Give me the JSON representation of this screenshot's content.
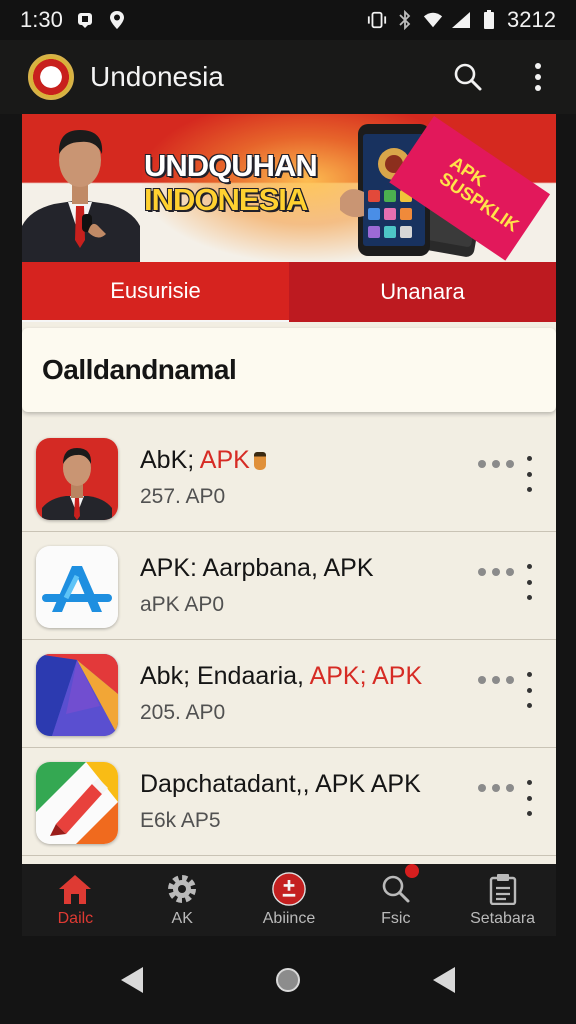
{
  "status_bar": {
    "time": "1:30",
    "right_text": "3212",
    "icons": [
      "notification-icon",
      "location-icon",
      "vibrate-icon",
      "bluetooth-icon",
      "wifi-icon",
      "signal-icon",
      "battery-icon"
    ]
  },
  "app_bar": {
    "title": "Undonesia",
    "logo": "app-logo",
    "actions": [
      "search-icon",
      "more-vert-icon"
    ]
  },
  "banner": {
    "line1": "UNDQUHAN",
    "line2": "INDONESIA",
    "badge_line1": "APK",
    "badge_line2": "SUSPKLIK"
  },
  "tabs": [
    {
      "label": "Eusurisie",
      "active": true
    },
    {
      "label": "Unanara",
      "active": false
    }
  ],
  "section": {
    "title": "Oalldandnamal"
  },
  "apps": [
    {
      "name": "AbK; ",
      "name_accent": "APK",
      "meta": "257. AP0",
      "icon": "portrait-icon"
    },
    {
      "name": "APK: Aarpbana, APK",
      "name_accent": "",
      "meta": "aPK AP0",
      "icon": "app-store-icon"
    },
    {
      "name": "Abk; Endaaria, ",
      "name_accent": "APK; APK",
      "meta": "205. AP0",
      "icon": "colorful-arrow-icon"
    },
    {
      "name": "Dapchatadant,, APK APK",
      "name_accent": "",
      "meta": "E6k AP5",
      "icon": "brush-icon"
    }
  ],
  "bottom_nav": [
    {
      "label": "Dailc",
      "icon": "home-icon",
      "active": true
    },
    {
      "label": "AK",
      "icon": "settings-icon",
      "active": false
    },
    {
      "label": "Abiince",
      "icon": "plus-minus-icon",
      "active": false
    },
    {
      "label": "Fsic",
      "icon": "search-icon",
      "active": false
    },
    {
      "label": "Setabara",
      "icon": "clipboard-icon",
      "active": false
    }
  ],
  "colors": {
    "primary_red": "#d6231f",
    "accent_red": "#d62b24",
    "content_bg": "#f2eee3",
    "card_bg": "#fdfaf0",
    "nav_bg": "#1b1b1b"
  }
}
